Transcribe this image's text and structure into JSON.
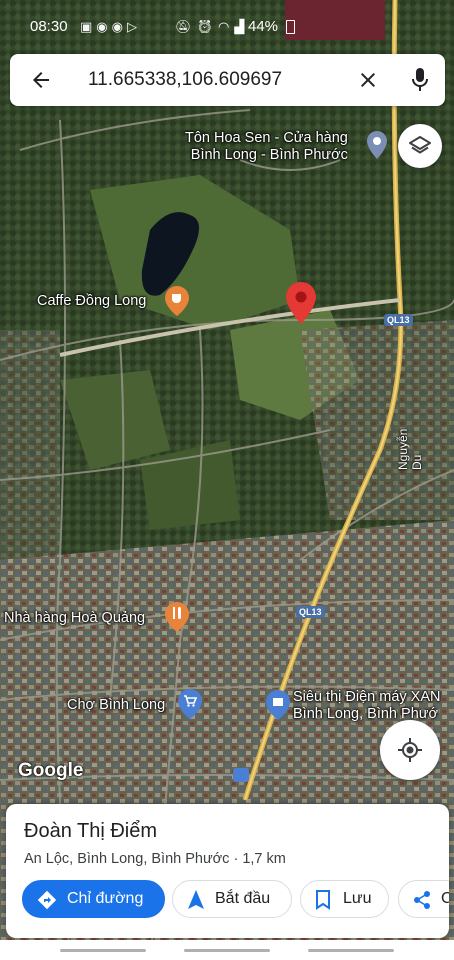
{
  "status_bar": {
    "time": "08:30",
    "notification_icons": [
      "s-icon",
      "messenger-icon",
      "messenger-icon",
      "play-icon"
    ],
    "battery": "44%"
  },
  "search": {
    "query": "11.665338,106.609697"
  },
  "map": {
    "labels": {
      "poi_ton_hoa_sen_line1": "Tôn Hoa Sen - Cửa hàng",
      "poi_ton_hoa_sen_line2": "Bình Long - Bình Phước",
      "poi_caffe": "Caffe Đồng Long",
      "poi_restaurant": "Nhà hàng Hoà Quảng",
      "poi_market": "Chợ Bình Long",
      "poi_supermarket_line1": "Siêu thị Điện máy XAN",
      "poi_supermarket_line2": "Bình Long, Bình Phướ",
      "road_ql13_top": "QL13",
      "road_ql13_mid": "QL13",
      "road_nguyen_du": "Nguyễn Du"
    },
    "attribution": "Google"
  },
  "place_card": {
    "title": "Đoàn Thị Điểm",
    "subtitle": "An Lộc, Bình Long, Bình Phước · 1,7 km",
    "actions": {
      "directions": "Chỉ đường",
      "start": "Bắt đầu",
      "save": "Lưu",
      "share": "C"
    }
  },
  "colors": {
    "accent": "#1a73e8",
    "pin": "#e53935",
    "road_major": "#d8b24a"
  }
}
